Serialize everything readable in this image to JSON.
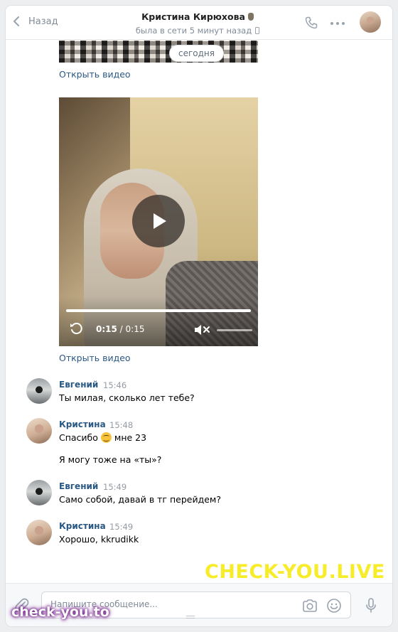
{
  "header": {
    "back_label": "Назад",
    "contact_name": "Кристина Кирюхова",
    "status": "была в сети 5 минут назад"
  },
  "chat": {
    "date_separator": "сегодня",
    "open_video_label": "Открыть видео",
    "video": {
      "time_current": "0:15",
      "time_separator": " / ",
      "time_total": "0:15",
      "progress_fraction": 1.0
    },
    "messages": [
      {
        "author": "Евгений",
        "time": "15:46",
        "lines": [
          "Ты милая, сколько лет тебе?"
        ]
      },
      {
        "author": "Кристина",
        "time": "15:48",
        "lines": [
          "Спасибо",
          "мне 23",
          "Я могу тоже на «ты»?"
        ]
      },
      {
        "author": "Евгений",
        "time": "15:49",
        "lines": [
          "Само собой, давай в тг перейдем?"
        ]
      },
      {
        "author": "Кристина",
        "time": "15:49",
        "lines": [
          "Хорошо, kkrudikk"
        ]
      }
    ]
  },
  "composer": {
    "placeholder": "Напишите сообщение..."
  },
  "watermarks": {
    "big": "CHECK-YOU.LIVE",
    "small": "check-you.to"
  },
  "colors": {
    "link": "#2a5885",
    "muted": "#818c99",
    "watermark_yellow": "#f7ec2a"
  }
}
